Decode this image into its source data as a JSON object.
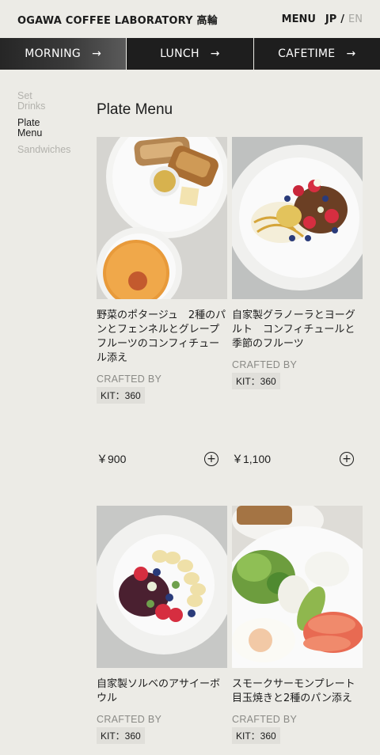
{
  "header": {
    "brand": "OGAWA COFFEE LABORATORY 高輪",
    "menu": "MENU",
    "lang_jp": "JP",
    "lang_sep": "/",
    "lang_en": "EN"
  },
  "tabs": [
    {
      "label": "MORNING",
      "active": true
    },
    {
      "label": "LUNCH",
      "active": false
    },
    {
      "label": "CAFETIME",
      "active": false
    }
  ],
  "tab_arrow": "→",
  "sidebar": {
    "items": [
      {
        "label": "Set Drinks",
        "active": false
      },
      {
        "label": "Plate Menu",
        "active": true
      },
      {
        "label": "Sandwiches",
        "active": false
      }
    ]
  },
  "main": {
    "title": "Plate Menu",
    "crafted_label": "CRAFTED BY",
    "items": [
      {
        "name": "野菜のポタージュ　2種のパンとフェンネルとグレープフルーツのコンフィチュール添え",
        "badge": "KIT：360",
        "price": "￥900",
        "image": "bread-and-soup-photo"
      },
      {
        "name": "自家製グラノーラとヨーグルト　コンフィチュールと季節のフルーツ",
        "badge": "KIT：360",
        "price": "￥1,100",
        "image": "granola-yogurt-photo"
      },
      {
        "name": "自家製ソルベのアサイーボウル",
        "badge": "KIT：360",
        "image": "acai-bowl-photo"
      },
      {
        "name": "スモークサーモンプレート　目玉焼きと2種のパン添え",
        "badge": "KIT：360",
        "image": "smoked-salmon-plate-photo"
      }
    ]
  },
  "add_icon": "plus-circle-icon"
}
